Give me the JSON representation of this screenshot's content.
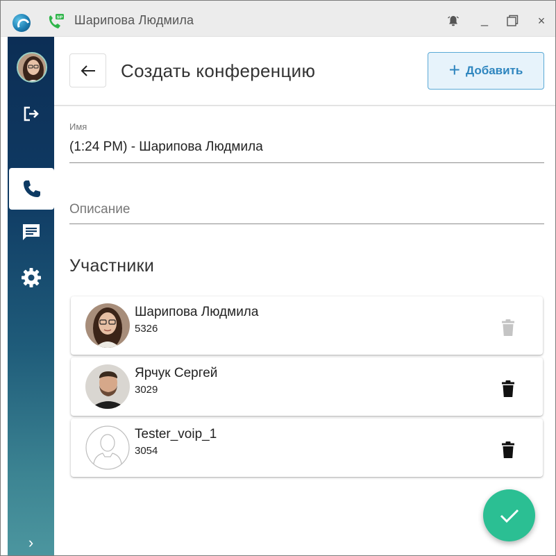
{
  "window": {
    "title": "Шарипова Людмила"
  },
  "titlebar_icons": [
    "app-logo-icon",
    "sip-phone-icon",
    "alarm-icon",
    "minimize-icon",
    "maximize-icon",
    "close-icon"
  ],
  "sidebar": {
    "items": [
      {
        "name": "user-avatar"
      },
      {
        "icon": "logout-icon"
      },
      {
        "icon": "phone-icon",
        "active": true
      },
      {
        "icon": "chat-icon"
      },
      {
        "icon": "gear-icon"
      },
      {
        "icon": "chevron-right-icon"
      }
    ],
    "expand_glyph": "›"
  },
  "header": {
    "title": "Создать конференцию",
    "add_label": "Добавить",
    "add_glyph": "+",
    "back_glyph": "←"
  },
  "form": {
    "name_label": "Имя",
    "name_value": "(1:24 PM) - Шарипова Людмила",
    "description_placeholder": "Описание"
  },
  "participants": {
    "title": "Участники",
    "items": [
      {
        "name": "Шарипова Людмила",
        "ext": "5326",
        "avatar": "photo-woman",
        "delete_enabled": false
      },
      {
        "name": "Ярчук Сергей",
        "ext": "3029",
        "avatar": "photo-man",
        "delete_enabled": true
      },
      {
        "name": "Tester_voip_1",
        "ext": "3054",
        "avatar": "placeholder",
        "delete_enabled": true
      }
    ]
  },
  "colors": {
    "accent": "#2f86bf",
    "fab": "#2bbf93",
    "rail_top": "#0c2e55",
    "rail_bottom": "#4c969f"
  }
}
